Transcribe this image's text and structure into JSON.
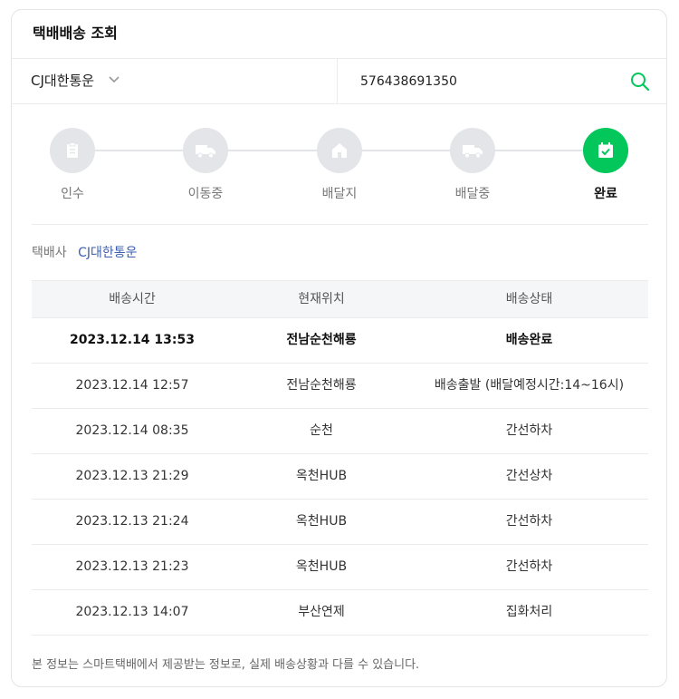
{
  "header": {
    "title": "택배배송 조회"
  },
  "search": {
    "carrier": "CJ대한통운",
    "tracking_number": "576438691350"
  },
  "steps": [
    {
      "label": "인수",
      "icon": "receipt-icon",
      "done": false
    },
    {
      "label": "이동중",
      "icon": "truck-icon",
      "done": false
    },
    {
      "label": "배달지",
      "icon": "house-icon",
      "done": false
    },
    {
      "label": "배달중",
      "icon": "truck-icon",
      "done": false
    },
    {
      "label": "완료",
      "icon": "calendar-check-icon",
      "done": true
    }
  ],
  "carrier_info": {
    "label": "택배사",
    "value": "CJ대한통운"
  },
  "table": {
    "headers": [
      "배송시간",
      "현재위치",
      "배송상태"
    ],
    "rows": [
      [
        "2023.12.14 13:53",
        "전남순천해룡",
        "배송완료"
      ],
      [
        "2023.12.14 12:57",
        "전남순천해룡",
        "배송출발 (배달예정시간:14~16시)"
      ],
      [
        "2023.12.14 08:35",
        "순천",
        "간선하차"
      ],
      [
        "2023.12.13 21:29",
        "옥천HUB",
        "간선상차"
      ],
      [
        "2023.12.13 21:24",
        "옥천HUB",
        "간선하차"
      ],
      [
        "2023.12.13 21:23",
        "옥천HUB",
        "간선하차"
      ],
      [
        "2023.12.13 14:07",
        "부산연제",
        "집화처리"
      ]
    ]
  },
  "footnote": "본 정보는 스마트택배에서 제공받는 정보로, 실제 배송상황과 다를 수 있습니다.",
  "colors": {
    "accent": "#03c75a",
    "carrier_link": "#3b5fad",
    "inactive_step": "#e3e5e8"
  }
}
